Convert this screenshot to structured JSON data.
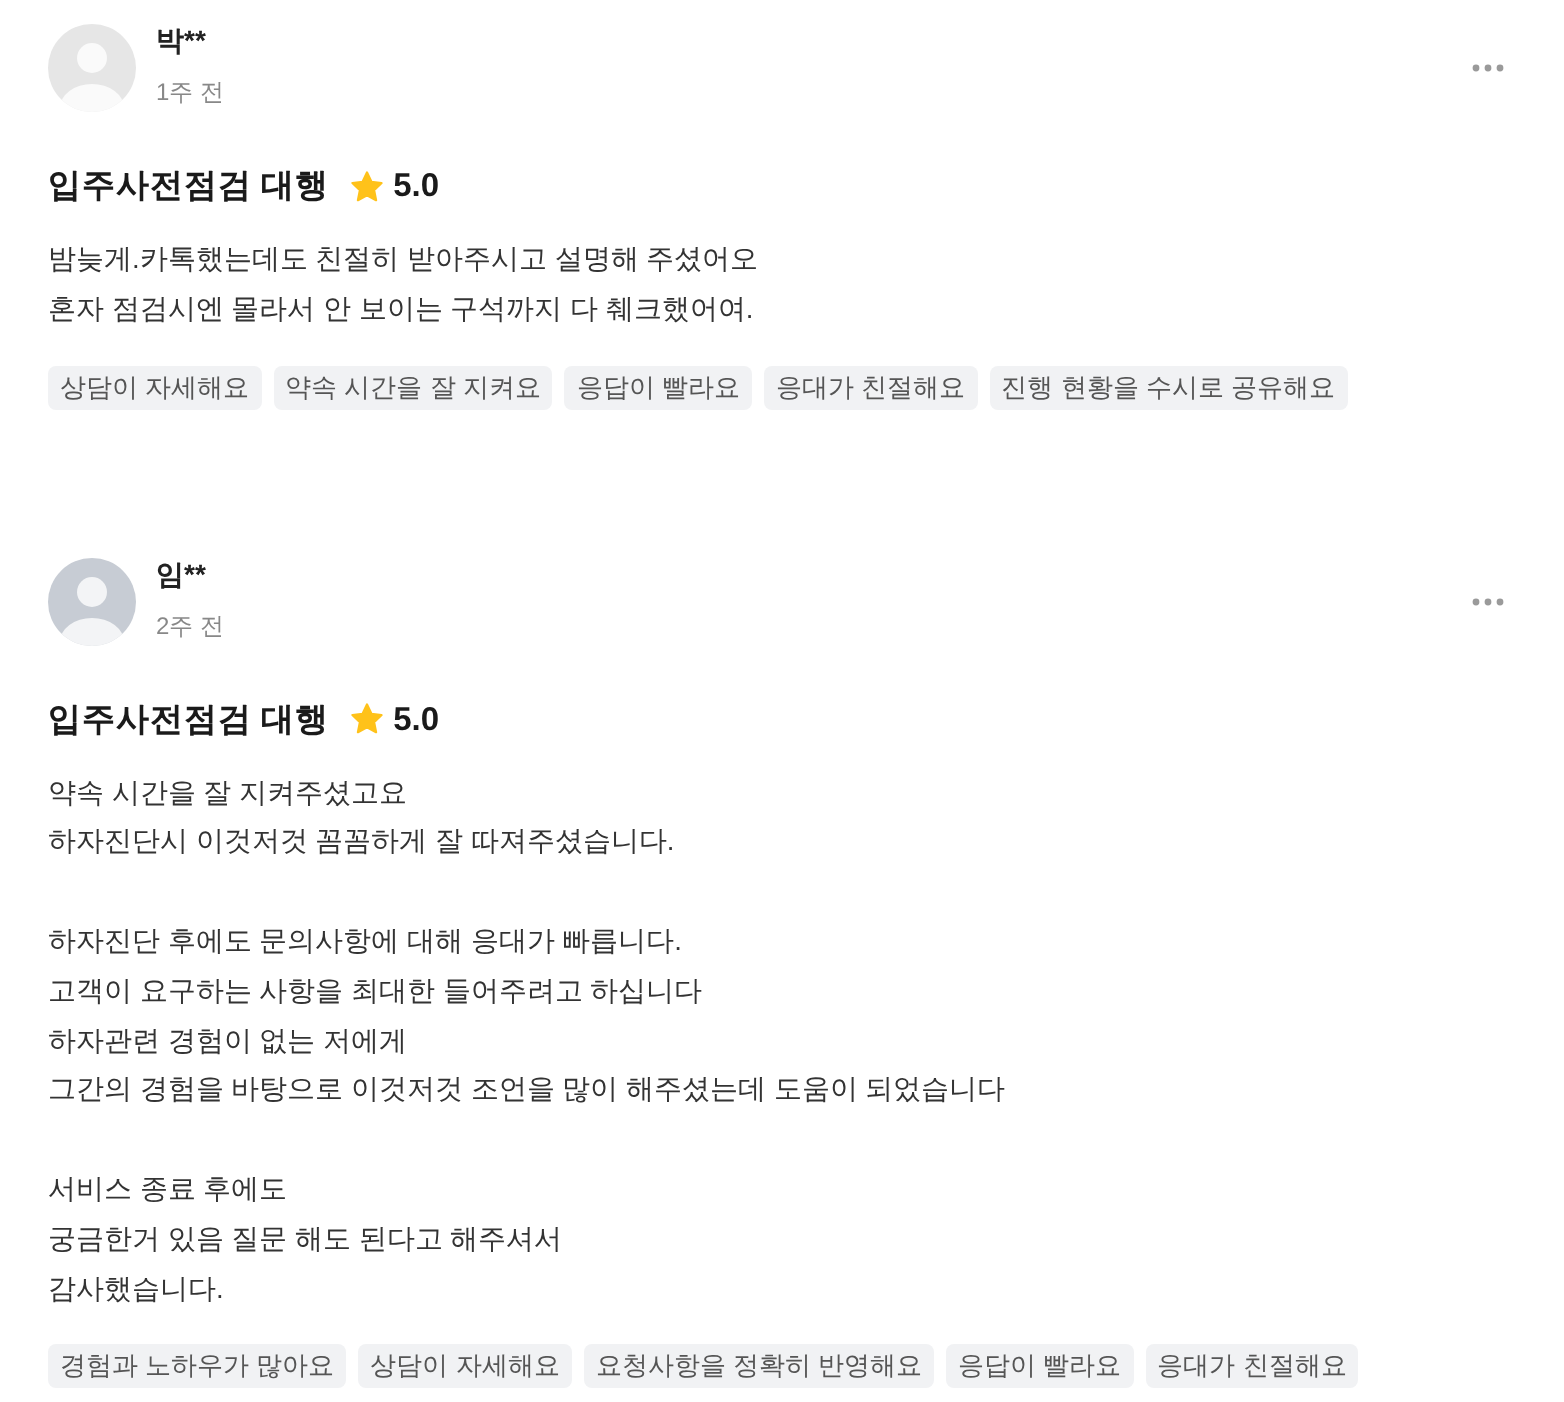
{
  "reviews": [
    {
      "author": "박**",
      "avatar": {
        "color": "#e6e6e6"
      },
      "time": "1주 전",
      "service": "입주사전점검 대행",
      "rating": "5.0",
      "body": [
        "밤늦게.카톡했는데도 친절히 받아주시고 설명해 주셨어오\n혼자 점검시엔 몰라서 안 보이는 구석까지 다 췌크했어여."
      ],
      "tags": [
        "상담이 자세해요",
        "약속 시간을 잘 지켜요",
        "응답이 빨라요",
        "응대가 친절해요",
        "진행 현황을 수시로 공유해요"
      ]
    },
    {
      "author": "임**",
      "avatar": {
        "color": "#c7ccd4"
      },
      "time": "2주 전",
      "service": "입주사전점검 대행",
      "rating": "5.0",
      "body": [
        "약속 시간을 잘 지켜주셨고요\n하자진단시 이것저것 꼼꼼하게 잘 따져주셨습니다.",
        "하자진단 후에도 문의사항에 대해 응대가 빠릅니다.\n고객이 요구하는 사항을 최대한 들어주려고 하십니다\n하자관련 경험이 없는 저에게\n그간의 경험을 바탕으로 이것저것 조언을 많이 해주셨는데 도움이 되었습니다",
        "서비스 종료 후에도\n궁금한거 있음 질문 해도 된다고 해주셔서\n감사했습니다."
      ],
      "tags": [
        "경험과 노하우가 많아요",
        "상담이 자세해요",
        "요청사항을 정확히 반영해요",
        "응답이 빨라요",
        "응대가 친절해요"
      ]
    }
  ]
}
